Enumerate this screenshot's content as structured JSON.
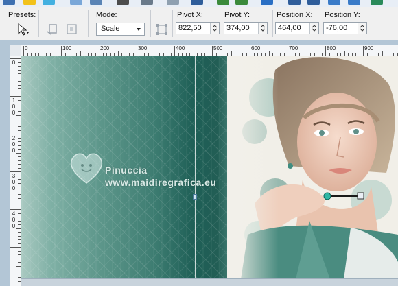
{
  "toolbar": {
    "presets_label": "Presets:",
    "mode_label": "Mode:",
    "mode_value": "Scale",
    "pivot_x_label": "Pivot X:",
    "pivot_x_value": "822,50",
    "pivot_y_label": "Pivot Y:",
    "pivot_y_value": "374,00",
    "position_x_label": "Position X:",
    "position_x_value": "464,00",
    "position_y_label": "Position Y:",
    "position_y_value": "-76,00"
  },
  "ruler": {
    "h_labels": [
      "0",
      "100",
      "200",
      "300",
      "400",
      "500",
      "600",
      "700",
      "800",
      "900"
    ],
    "v_labels": [
      "0",
      "1\n0\n0",
      "2\n0\n0",
      "3\n0\n0",
      "4\n0\n0"
    ]
  },
  "watermark": {
    "name": "Pinuccia",
    "url": "www.maidiregrafica.eu"
  },
  "icons": {
    "top_strip": [
      "grid-icon",
      "pencil-icon",
      "bucket-icon",
      "window-icon",
      "save-icon",
      "print-icon",
      "arrow-icon",
      "ruler-icon",
      "tool-icon",
      "undo-icon",
      "redo-icon",
      "help-icon",
      "layers-icon",
      "settings-icon",
      "zoom-in-icon",
      "zoom-out-icon",
      "globe-icon"
    ],
    "pick_tool": "pick-arrow-icon",
    "object_button": "object-icon",
    "grid_button": "grid-icon",
    "pivot_button": "pivot-icon"
  },
  "colors": {
    "canvas_teal": "#1e5f56",
    "workspace": "#b3c6d6",
    "toolbar_bg": "#f0f0f0"
  }
}
